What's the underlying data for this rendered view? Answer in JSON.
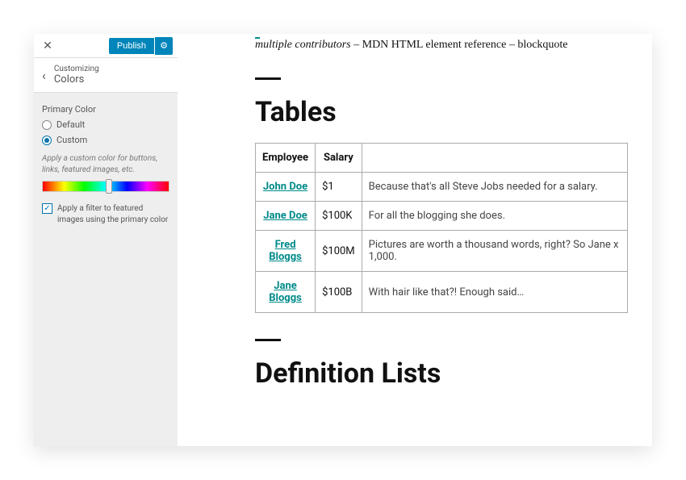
{
  "sidebar": {
    "publish_label": "Publish",
    "customizing_label": "Customizing",
    "section_title": "Colors",
    "primary_color_label": "Primary Color",
    "option_default": "Default",
    "option_custom": "Custom",
    "help_text": "Apply a custom color for buttons, links, featured images, etc.",
    "filter_checkbox_label": "Apply a filter to featured images using the primary color",
    "accent_color": "#008a8a"
  },
  "preview": {
    "cite_italic": "multiple contributors",
    "cite_sep1": " – ",
    "cite_mid": "MDN HTML element reference",
    "cite_sep2": " – ",
    "cite_end": "blockquote",
    "heading_tables": "Tables",
    "heading_deflists": "Definition Lists",
    "table": {
      "headers": [
        "Employee",
        "Salary",
        ""
      ],
      "rows": [
        {
          "name": "John Doe",
          "salary": "$1",
          "note": "Because that's all Steve Jobs needed for a salary."
        },
        {
          "name": "Jane Doe",
          "salary": "$100K",
          "note": "For all the blogging she does."
        },
        {
          "name": "Fred Bloggs",
          "salary": "$100M",
          "note": "Pictures are worth a thousand words, right? So Jane x 1,000."
        },
        {
          "name": "Jane Bloggs",
          "salary": "$100B",
          "note": "With hair like that?! Enough said…"
        }
      ]
    }
  }
}
